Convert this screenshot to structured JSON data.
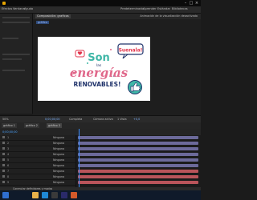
{
  "window": {
    "title": ""
  },
  "menu": {
    "items": [
      "Efectos",
      "Ventana",
      "Ayuda",
      "Predeterminado",
      "Aprender",
      "Estándar",
      "Bibliotecas"
    ]
  },
  "composition": {
    "tab_label": "Composición: graficos",
    "sub_label": "gráfico",
    "active_message": "Animación de la visualización desactivada"
  },
  "artwork": {
    "word_son": "Son",
    "word_las": "las",
    "word_energias": "energías",
    "word_renovables": "RENOVABLES!",
    "bubble_text": "Suenala!"
  },
  "viewer_bar": {
    "zoom": "50%",
    "timecode": "0;00;00;00",
    "resolution": "Completa",
    "camera": "Cámara activa",
    "views": "1 Vista",
    "offset": "+0,0"
  },
  "timeline": {
    "tabs": [
      "gráfico 1",
      "gráfico 2",
      "gráfico 3"
    ],
    "timecode": "0;00;00;00",
    "layers": [
      {
        "index": "1",
        "name": "Ninguno"
      },
      {
        "index": "2",
        "name": "Ninguno"
      },
      {
        "index": "3",
        "name": "Ninguno"
      },
      {
        "index": "4",
        "name": "Ninguno"
      },
      {
        "index": "5",
        "name": "Ninguno"
      },
      {
        "index": "6",
        "name": "Ninguno"
      },
      {
        "index": "7",
        "name": "Ninguno"
      },
      {
        "index": "8",
        "name": "Ninguno"
      },
      {
        "index": "9",
        "name": "Ninguno"
      }
    ]
  },
  "status": {
    "text": "Conmutar definidores y modos"
  },
  "colors": {
    "teal": "#3fb7a7",
    "pink": "#e0678a",
    "navy": "#20336b",
    "red_bubble": "#e2354c",
    "track_purple": "#6c6a9a",
    "track_red": "#b9545a",
    "accent_blue": "#3a8cff"
  }
}
